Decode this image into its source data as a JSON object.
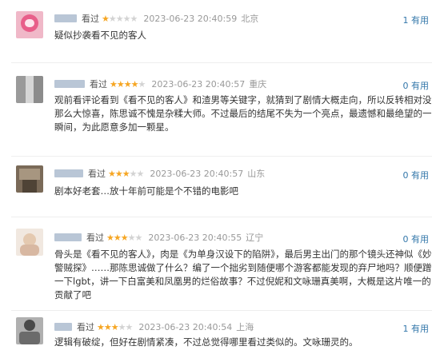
{
  "colors": {
    "star_on": "#f6a623",
    "star_off": "#d3d3d3",
    "useful_link": "#3377aa",
    "meta_gray": "#999999"
  },
  "reviews": [
    {
      "watched": "看过",
      "rating": 1,
      "datetime": "2023-06-23 20:40:59",
      "location": "北京",
      "useful": "1 有用",
      "content": "疑似抄袭看不见的客人"
    },
    {
      "watched": "看过",
      "rating": 4,
      "datetime": "2023-06-23 20:40:57",
      "location": "重庆",
      "useful": "0 有用",
      "content": "观前看评论看到《看不见的客人》和渣男等关键字，就猜到了剧情大概走向，所以反转相对没那么大惊喜，陈思诚不愧是杂糅大师。不过最后的结尾不失为一个亮点，最遗憾和最绝望的一瞬间，为此愿意多加一颗星。"
    },
    {
      "watched": "看过",
      "rating": 3,
      "datetime": "2023-06-23 20:40:57",
      "location": "山东",
      "useful": "0 有用",
      "content": "剧本好老套…放十年前可能是个不错的电影吧"
    },
    {
      "watched": "看过",
      "rating": 3,
      "datetime": "2023-06-23 20:40:55",
      "location": "辽宁",
      "useful": "0 有用",
      "content": "骨头是《看不见的客人》，肉是《为单身汉设下的陷阱》，最后男主出门的那个镜头还神似《妙警贼探》……那陈思诚做了什么？编了一个拙劣到随便哪个游客都能发现的弃尸地吗？顺便蹭一下lgbt，讲一下白富美和凤凰男的烂俗故事？不过倪妮和文咏珊真美啊，大概是这片唯一的贡献了吧"
    },
    {
      "watched": "看过",
      "rating": 3,
      "datetime": "2023-06-23 20:40:54",
      "location": "上海",
      "useful": "1 有用",
      "content": "逻辑有破绽，但好在剧情紧凑，不过总觉得哪里看过类似的。文咏珊灵的。"
    }
  ]
}
